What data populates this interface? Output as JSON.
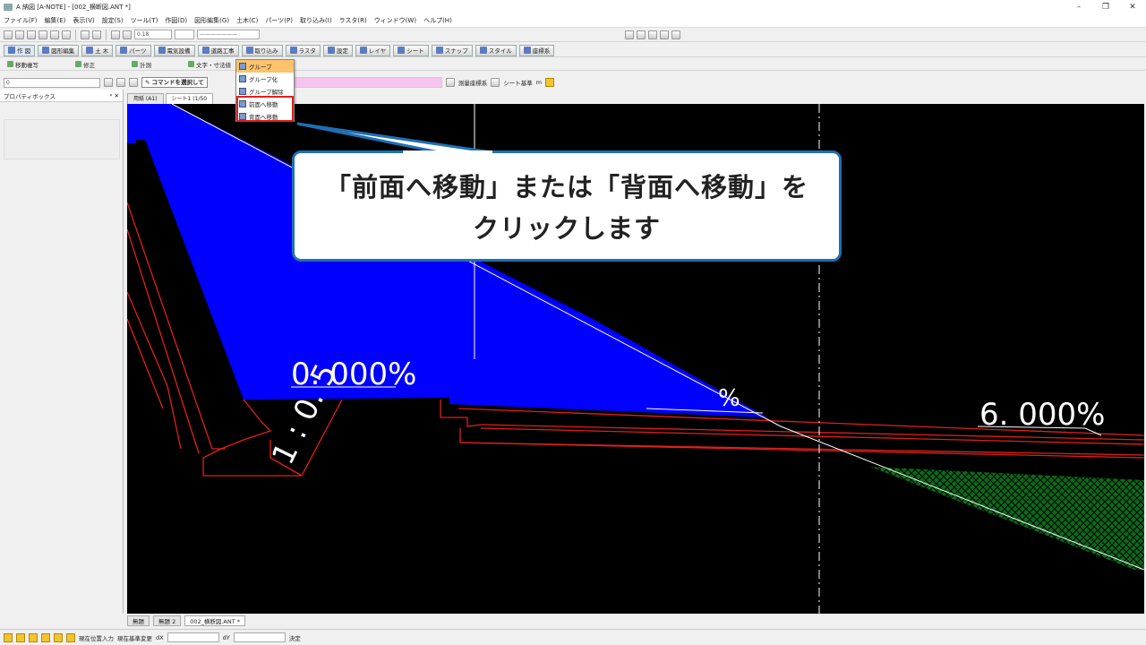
{
  "window": {
    "title": "A 納図 [A-NOTE] - [002_横断図.ANT *]",
    "controls": [
      "–",
      "❐",
      "✕"
    ]
  },
  "menu": {
    "items": [
      "ファイル(F)",
      "編集(E)",
      "表示(V)",
      "設定(S)",
      "ツール(T)",
      "作図(D)",
      "図形編集(G)",
      "土木(C)",
      "パーツ(P)",
      "取り込み(I)",
      "ラスタ(R)",
      "ウィンドウ(W)",
      "ヘルプ(H)"
    ]
  },
  "toolbar": {
    "line_width_label": "0.18",
    "line_type_label": "———————"
  },
  "ribbon_tabs": [
    {
      "label": "作 図",
      "active": true
    },
    {
      "label": "図形編集",
      "active": false
    },
    {
      "label": "土 木",
      "active": false
    },
    {
      "label": "パーツ",
      "active": false
    },
    {
      "label": "電気設備",
      "active": false
    },
    {
      "label": "道路工事",
      "active": false
    },
    {
      "label": "取り込み",
      "active": false
    },
    {
      "label": "ラスタ",
      "active": false
    },
    {
      "label": "設定",
      "active": false
    },
    {
      "label": "レイヤ",
      "active": false
    },
    {
      "label": "シート",
      "active": false
    },
    {
      "label": "スナップ",
      "active": false
    },
    {
      "label": "スタイル",
      "active": false
    },
    {
      "label": "座標系",
      "active": false
    }
  ],
  "sub_toolbar": [
    "移動複写",
    "修正",
    "計測",
    "文字・寸法値"
  ],
  "prop_row": {
    "layer_value": "0",
    "command_box": "コマンドを選択して",
    "coord_system": "測量座標系",
    "sheet_basis": "シート基準",
    "unit": "m"
  },
  "left_panel": {
    "title": "プロパティボックス",
    "controls": "ᵖ ✕"
  },
  "doc_tabs": [
    {
      "label": "用紙 (A1)",
      "active": false
    },
    {
      "label": "シート1 (1/50",
      "active": true
    }
  ],
  "dropdown": {
    "items": [
      {
        "label": "グループ",
        "highlighted": true
      },
      {
        "label": "グループ化",
        "highlighted": false
      },
      {
        "label": "グループ解除",
        "highlighted": false
      },
      {
        "label": "前面へ移動",
        "highlighted": false
      },
      {
        "label": "背面へ移動",
        "highlighted": false
      }
    ]
  },
  "callout": {
    "line1": "「前面へ移動」または「背面へ移動」を",
    "line2": "クリックします"
  },
  "drawing": {
    "slope_left": "0. 000%",
    "slope_ratio": "1 : 0. 5",
    "slope_right": "6. 000%",
    "slope_partial": "%"
  },
  "bottom_tabs": [
    {
      "label": "無題",
      "active": false
    },
    {
      "label": "無題 2",
      "active": false
    },
    {
      "label": "002_横断図.ANT *",
      "active": true
    }
  ],
  "status": {
    "pos_input": "現在位置入力",
    "base_change": "現在基準変更",
    "dx": "dX",
    "dy": "dY",
    "confirm": "決定"
  },
  "colors": {
    "canvas_bg": "#000000",
    "fill_blue": "#0000ff",
    "line_red": "#e0201c",
    "hatch_green": "#0a6a1a",
    "callout_border": "#1f6fb5",
    "menu_highlight": "#fbc36b"
  }
}
